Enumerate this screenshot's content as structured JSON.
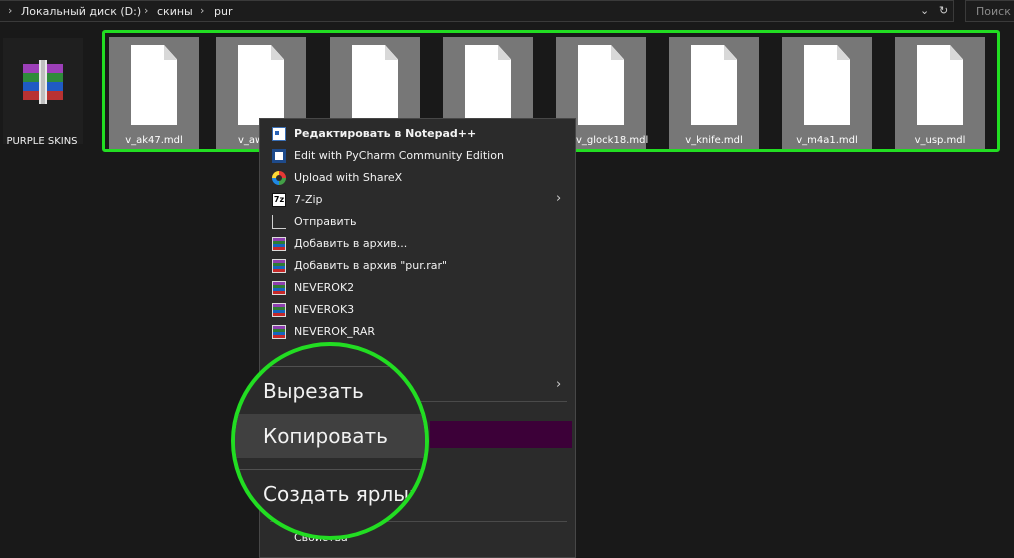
{
  "address_bar": {
    "crumbs": [
      "Локальный диск (D:)",
      "скины",
      "pur"
    ],
    "separator": "›",
    "back_glyph": "›",
    "dropdown_glyph": "⌄",
    "refresh_glyph": "↻"
  },
  "search": {
    "placeholder": "Поиск"
  },
  "files": [
    {
      "name": "PURPLE SKINS",
      "icon": "winrar-archive-icon"
    },
    {
      "name": "v_ak47.mdl",
      "icon": "file-icon"
    },
    {
      "name": "v_aw",
      "icon": "file-icon"
    },
    {
      "name": "",
      "icon": "file-icon"
    },
    {
      "name": "",
      "icon": "file-icon"
    },
    {
      "name": "v_glock18.mdl",
      "icon": "file-icon"
    },
    {
      "name": "v_knife.mdl",
      "icon": "file-icon"
    },
    {
      "name": "v_m4a1.mdl",
      "icon": "file-icon"
    },
    {
      "name": "v_usp.mdl",
      "icon": "file-icon"
    }
  ],
  "context_menu": {
    "items": [
      {
        "label": "Редактировать в Notepad++",
        "icon": "notepad-plus-plus-icon",
        "bold": true
      },
      {
        "label": "Edit with PyCharm Community Edition",
        "icon": "pycharm-icon"
      },
      {
        "label": "Upload with ShareX",
        "icon": "sharex-icon"
      },
      {
        "label": "7-Zip",
        "icon": "7zip-icon",
        "submenu": true
      },
      {
        "label": "Отправить",
        "icon": "share-icon"
      },
      {
        "label": "Добавить в архив...",
        "icon": "winrar-icon"
      },
      {
        "label": "Добавить в архив \"pur.rar\"",
        "icon": "winrar-icon"
      },
      {
        "label": "NEVEROK2",
        "icon": "winrar-icon"
      },
      {
        "label": "NEVEROK3",
        "icon": "winrar-icon"
      },
      {
        "label": "NEVEROK_RAR",
        "icon": "winrar-icon"
      },
      {
        "label": "Свойства",
        "icon": ""
      }
    ],
    "submenu_glyph": "›"
  },
  "magnifier": {
    "items": [
      "Вырезать",
      "Копировать",
      "Создать ярлык"
    ]
  },
  "colors": {
    "selection_outline": "#22dd22",
    "tile_selected": "#777777",
    "menu_bg": "#2b2b2b",
    "menu_highlight": "#3c0038"
  }
}
